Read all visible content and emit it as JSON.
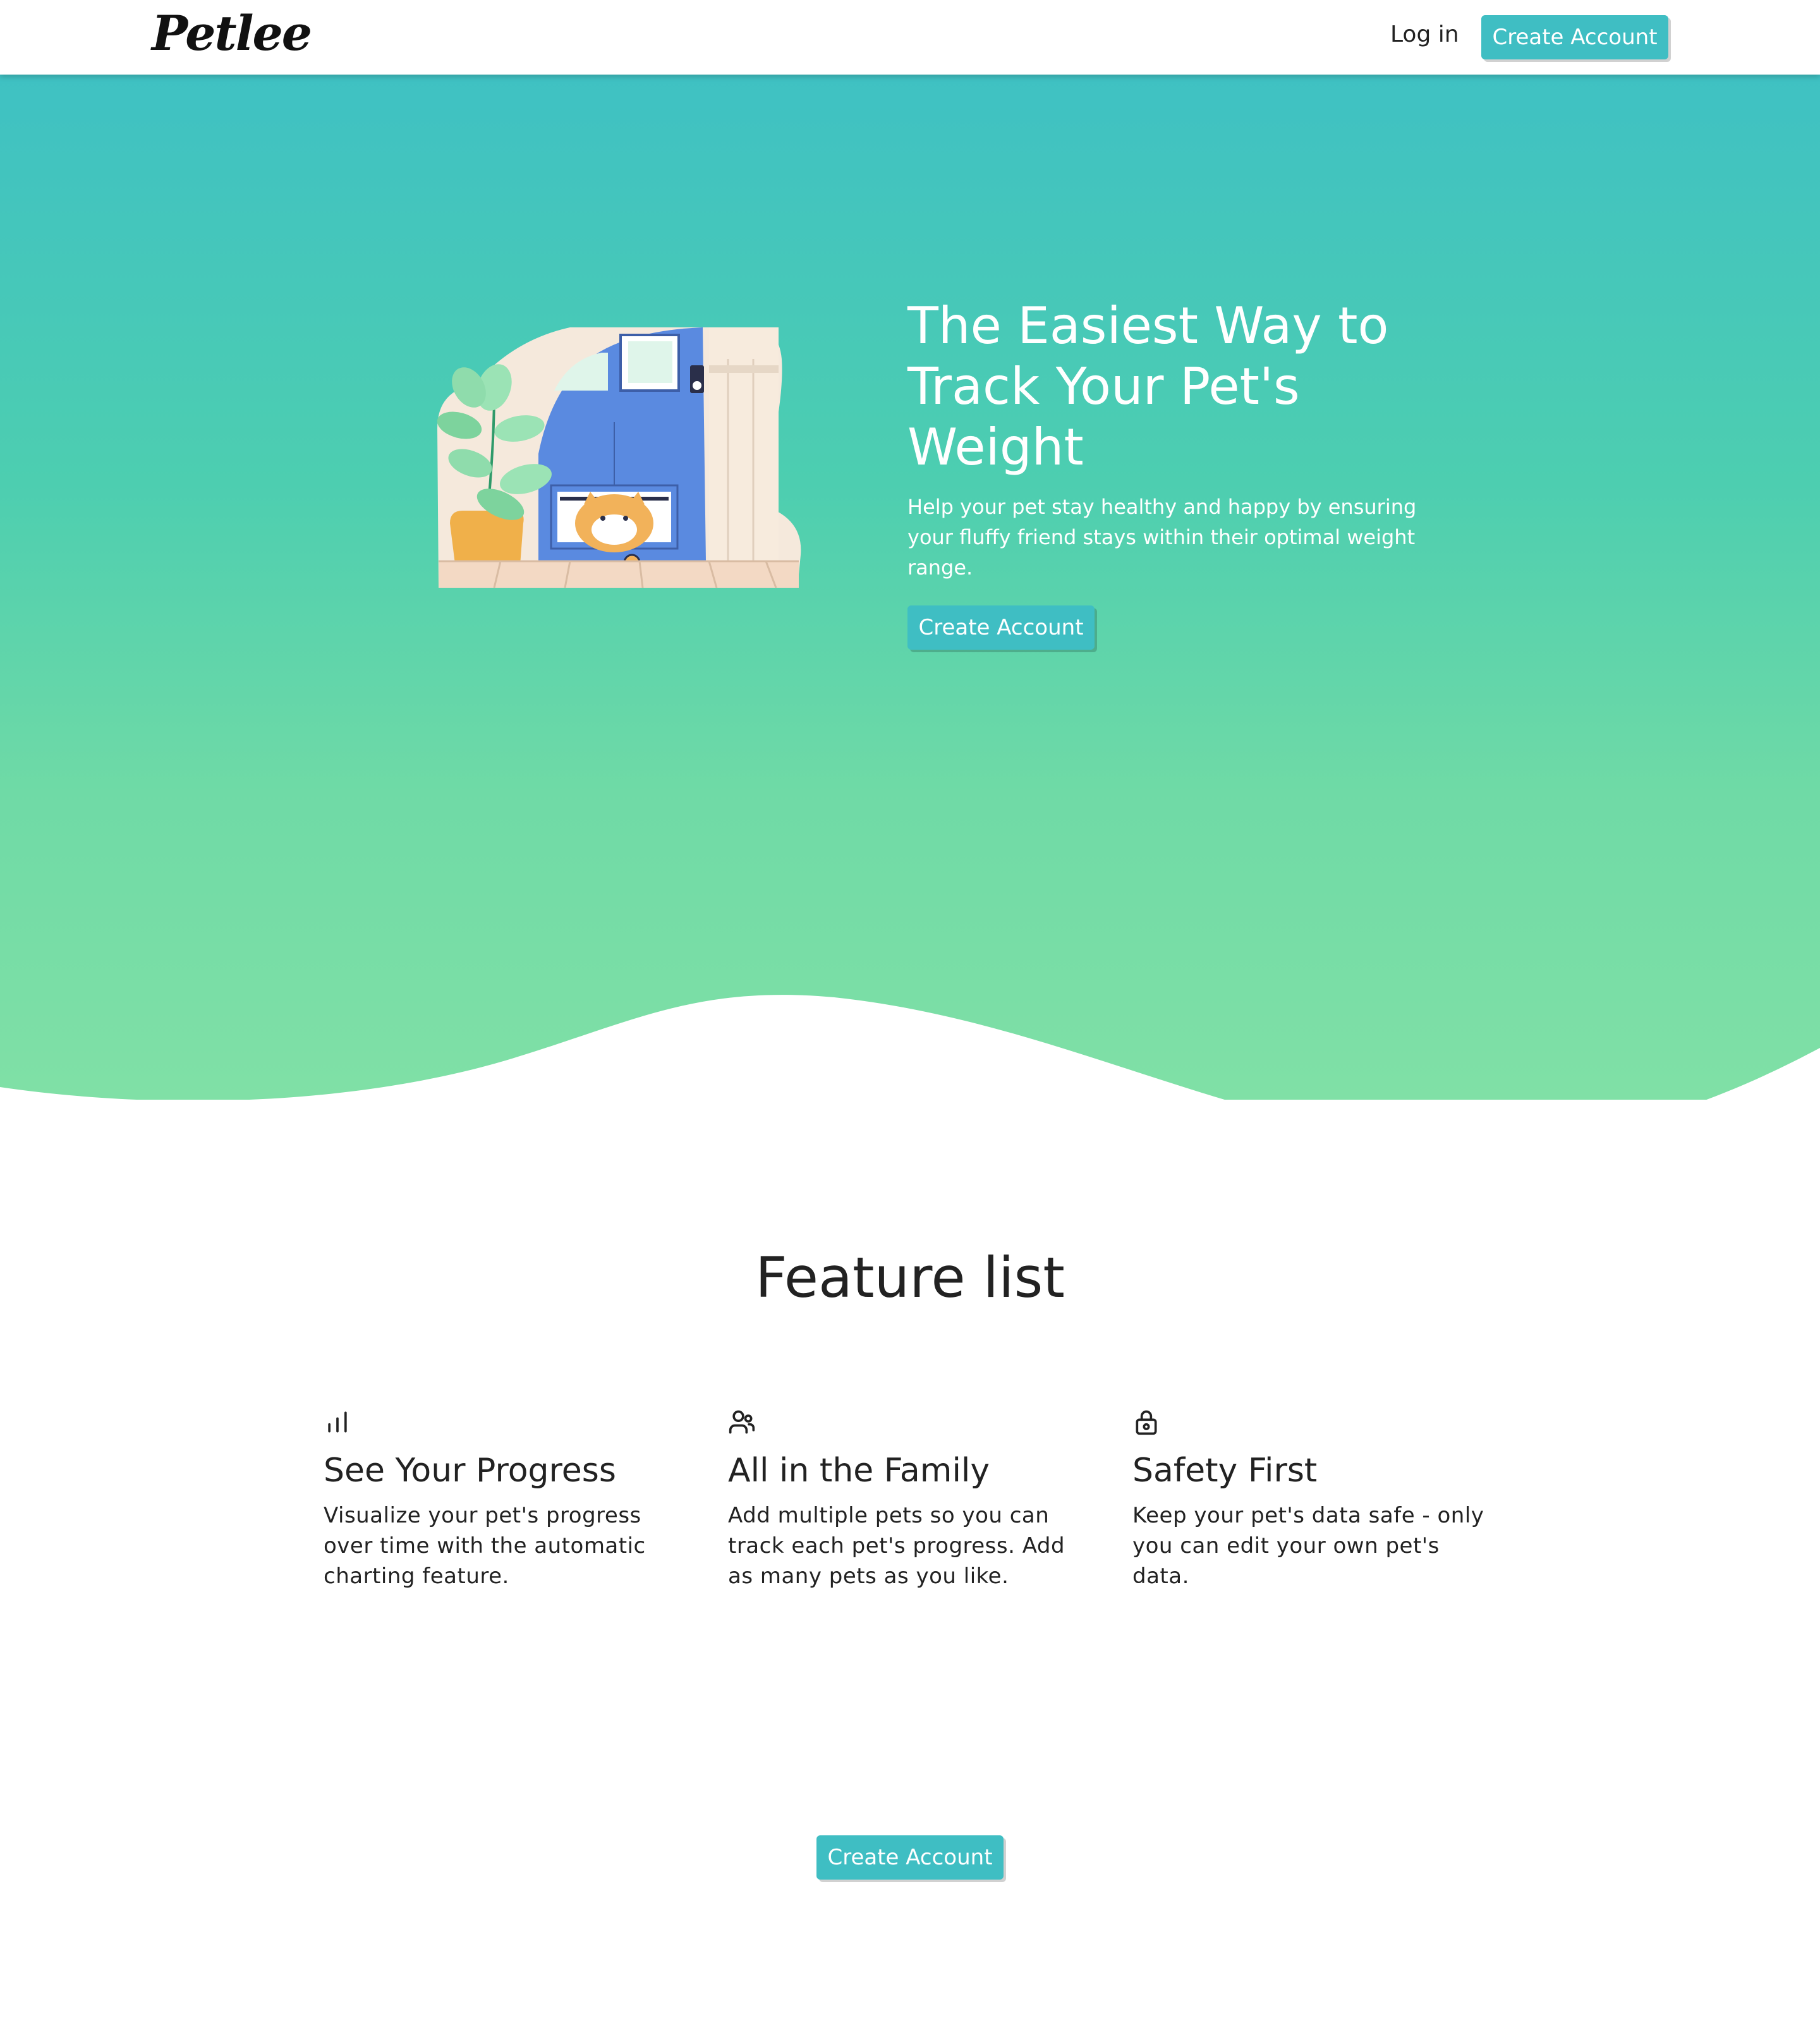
{
  "nav": {
    "logo": "Petlee",
    "login": "Log in",
    "create_account": "Create Account"
  },
  "hero": {
    "title": "The Easiest Way to Track Your Pet's Weight",
    "subtitle": "Help your pet stay healthy and happy by ensuring your fluffy friend stays within their optimal weight range.",
    "cta": "Create Account",
    "illustration": "cat-in-pet-door-illustration"
  },
  "features": {
    "title": "Feature list",
    "items": [
      {
        "icon": "bar-chart-icon",
        "title": "See Your Progress",
        "text": "Visualize your pet's progress over time with the automatic charting feature."
      },
      {
        "icon": "users-icon",
        "title": "All in the Family",
        "text": "Add multiple pets so you can track each pet's progress. Add as many pets as you like."
      },
      {
        "icon": "lock-icon",
        "title": "Safety First",
        "text": "Keep your pet's data safe - only you can edit your own pet's data."
      }
    ]
  },
  "footer_cta": "Create Account",
  "colors": {
    "accent": "#3fbec3",
    "hero_top": "#3fc1c3",
    "hero_bottom": "#80e0a6"
  }
}
